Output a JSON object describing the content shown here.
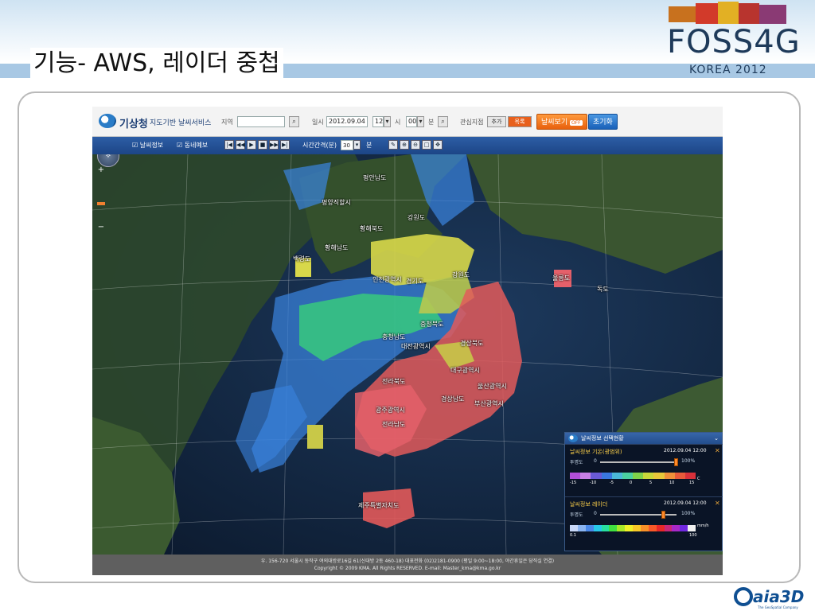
{
  "slide": {
    "title": "기능- AWS, 레이더 중첩",
    "conference_logo": "FOSS4G",
    "conference_sub": "KOREA 2012",
    "company_logo": "aia3D",
    "company_tagline": "The GeoSpatial Company"
  },
  "app": {
    "org_name": "기상청",
    "service_name": "지도기반 날씨서비스",
    "region_label": "지역",
    "region_value": "",
    "datetime_label": "일시",
    "date_value": "2012.09.04",
    "hour_value": "12",
    "hour_unit": "시",
    "minute_value": "00",
    "minute_unit": "분",
    "interest_label": "관심지점",
    "add_label": "추가",
    "list_label": "목록",
    "weather_view_label": "날씨보기",
    "weather_view_state": "OFF",
    "reset_label": "초기화"
  },
  "toolbar": {
    "weather_info": "날씨정보",
    "neighborhood_forecast": "동네예보",
    "interval_label": "시간간격(분)",
    "interval_value": "30",
    "interval_unit": "분",
    "playback": [
      "|◀",
      "◀◀",
      "▶",
      "■",
      "▶▶",
      "▶|"
    ],
    "tools": [
      "✎",
      "⊕",
      "⊖",
      "□",
      "✥"
    ]
  },
  "map": {
    "regions": [
      {
        "name": "평안남도"
      },
      {
        "name": "평양직할시"
      },
      {
        "name": "강원도"
      },
      {
        "name": "황해북도"
      },
      {
        "name": "황해남도"
      },
      {
        "name": "백령도"
      },
      {
        "name": "인천광역시"
      },
      {
        "name": "경기도"
      },
      {
        "name": "강원도"
      },
      {
        "name": "울릉도"
      },
      {
        "name": "독도"
      },
      {
        "name": "충청북도"
      },
      {
        "name": "충청남도"
      },
      {
        "name": "대전광역시"
      },
      {
        "name": "경상북도"
      },
      {
        "name": "대구광역시"
      },
      {
        "name": "전라북도"
      },
      {
        "name": "울산광역시"
      },
      {
        "name": "경상남도"
      },
      {
        "name": "부산광역시"
      },
      {
        "name": "광주광역시"
      },
      {
        "name": "전라남도"
      },
      {
        "name": "제주특별자치도"
      }
    ],
    "zoom_in": "+",
    "zoom_out": "−"
  },
  "panel": {
    "title": "날씨정보 선택현황",
    "temp": {
      "title": "날씨정보 기온(광범위)",
      "time": "2012.09.04 12:00",
      "opacity_label": "투명도",
      "opacity_min": "0",
      "opacity_max": "100%",
      "opacity_value": 1.0,
      "ticks": [
        "-15",
        "-10",
        "-5",
        "0",
        "5",
        "10",
        "15"
      ],
      "unit": "C",
      "colors": [
        "#b14fd8",
        "#c87fe6",
        "#6a5ad6",
        "#3a78e0",
        "#4ab8d8",
        "#4ad0a0",
        "#7ed24a",
        "#c8d83a",
        "#e8c83a",
        "#f0903a",
        "#e85a3a",
        "#d8303a"
      ]
    },
    "radar": {
      "title": "날씨정보 레이더",
      "time": "2012.09.04 12:00",
      "opacity_label": "투명도",
      "opacity_min": "0",
      "opacity_max": "100%",
      "opacity_value": 0.83,
      "ticks": [
        "0.1",
        "100"
      ],
      "unit": "mm/h",
      "colors": [
        "#c8d8f8",
        "#8ab4f0",
        "#4a88e8",
        "#28c8e8",
        "#28e0a0",
        "#40e040",
        "#a8e828",
        "#f0f028",
        "#f8c828",
        "#f89028",
        "#f85828",
        "#e82828",
        "#c82878",
        "#a828c8",
        "#7028e0",
        "#f0f0f0"
      ]
    }
  },
  "footer": {
    "line1": "우. 156-720 서울시 동작구 여의대방로16길 61(신대방 2동 460-18) 대표전화 (02)2181-0900 (평일 9:00~18:00, 야간휴일은 당직실 연결)",
    "line2": "Copyright © 2009 KMA. All Rights RESERVED. E-mail: Master_kma@kma.go.kr"
  }
}
